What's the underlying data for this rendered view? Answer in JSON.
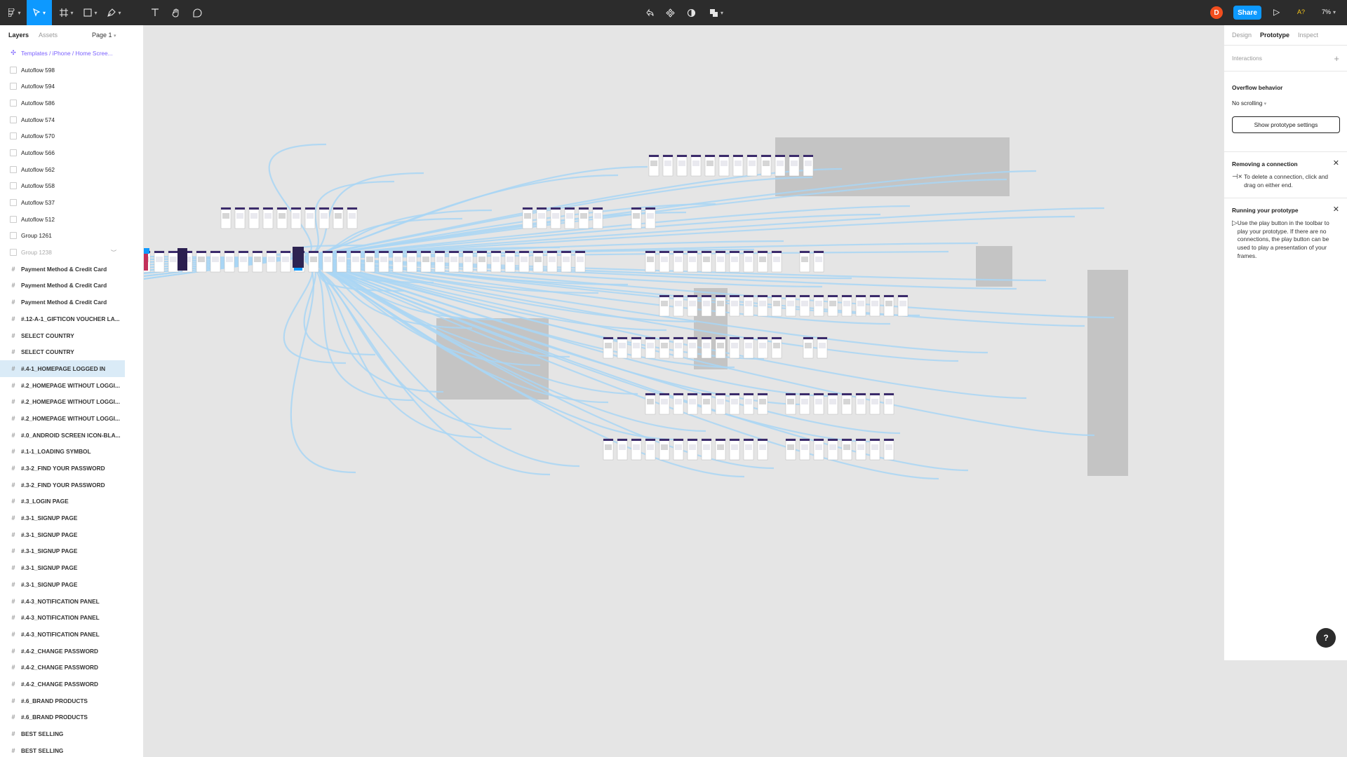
{
  "toolbar": {
    "user_initial": "D",
    "share_label": "Share",
    "aa_label": "A?",
    "zoom_label": "7%"
  },
  "left_panel": {
    "tab_layers": "Layers",
    "tab_assets": "Assets",
    "page_label": "Page 1",
    "layers": [
      {
        "label": "Templates / iPhone / Home Scree...",
        "kind": "component"
      },
      {
        "label": "Autoflow 598",
        "kind": "autoflow"
      },
      {
        "label": "Autoflow 594",
        "kind": "autoflow"
      },
      {
        "label": "Autoflow 586",
        "kind": "autoflow"
      },
      {
        "label": "Autoflow 574",
        "kind": "autoflow"
      },
      {
        "label": "Autoflow 570",
        "kind": "autoflow"
      },
      {
        "label": "Autoflow 566",
        "kind": "autoflow"
      },
      {
        "label": "Autoflow 562",
        "kind": "autoflow"
      },
      {
        "label": "Autoflow 558",
        "kind": "autoflow"
      },
      {
        "label": "Autoflow 537",
        "kind": "autoflow"
      },
      {
        "label": "Autoflow 512",
        "kind": "autoflow"
      },
      {
        "label": "Group 1261",
        "kind": "group"
      },
      {
        "label": "Group 1238",
        "kind": "group-hidden"
      },
      {
        "label": "Payment Method & Credit Card",
        "kind": "frame"
      },
      {
        "label": "Payment Method & Credit Card",
        "kind": "frame"
      },
      {
        "label": "Payment Method & Credit Card",
        "kind": "frame"
      },
      {
        "label": "#.12-A-1_GIFTICON VOUCHER LA...",
        "kind": "frame"
      },
      {
        "label": "SELECT COUNTRY",
        "kind": "frame"
      },
      {
        "label": "SELECT COUNTRY",
        "kind": "frame"
      },
      {
        "label": "#.4-1_HOMEPAGE LOGGED IN",
        "kind": "frame-selected"
      },
      {
        "label": "#.2_HOMEPAGE WITHOUT LOGGI...",
        "kind": "frame"
      },
      {
        "label": "#.2_HOMEPAGE WITHOUT LOGGI...",
        "kind": "frame"
      },
      {
        "label": "#.2_HOMEPAGE WITHOUT LOGGI...",
        "kind": "frame"
      },
      {
        "label": "#.0_ANDROID SCREEN ICON-BLA...",
        "kind": "frame"
      },
      {
        "label": "#.1-1_LOADING SYMBOL",
        "kind": "frame"
      },
      {
        "label": "#.3-2_FIND YOUR PASSWORD",
        "kind": "frame"
      },
      {
        "label": "#.3-2_FIND YOUR PASSWORD",
        "kind": "frame"
      },
      {
        "label": "#.3_LOGIN PAGE",
        "kind": "frame"
      },
      {
        "label": "#.3-1_SIGNUP PAGE",
        "kind": "frame"
      },
      {
        "label": "#.3-1_SIGNUP PAGE",
        "kind": "frame"
      },
      {
        "label": "#.3-1_SIGNUP PAGE",
        "kind": "frame"
      },
      {
        "label": "#.3-1_SIGNUP PAGE",
        "kind": "frame"
      },
      {
        "label": "#.3-1_SIGNUP PAGE",
        "kind": "frame"
      },
      {
        "label": "#.4-3_NOTIFICATION PANEL",
        "kind": "frame"
      },
      {
        "label": "#.4-3_NOTIFICATION PANEL",
        "kind": "frame"
      },
      {
        "label": "#.4-3_NOTIFICATION PANEL",
        "kind": "frame"
      },
      {
        "label": "#.4-2_CHANGE PASSWORD",
        "kind": "frame"
      },
      {
        "label": "#.4-2_CHANGE PASSWORD",
        "kind": "frame"
      },
      {
        "label": "#.4-2_CHANGE PASSWORD",
        "kind": "frame"
      },
      {
        "label": "#.6_BRAND PRODUCTS",
        "kind": "frame"
      },
      {
        "label": "#.6_BRAND PRODUCTS",
        "kind": "frame"
      },
      {
        "label": "BEST SELLING",
        "kind": "frame"
      },
      {
        "label": "BEST SELLING",
        "kind": "frame"
      }
    ]
  },
  "right_panel": {
    "tab_design": "Design",
    "tab_prototype": "Prototype",
    "tab_inspect": "Inspect",
    "interactions_label": "Interactions",
    "overflow_title": "Overflow behavior",
    "overflow_value": "No scrolling",
    "settings_button": "Show prototype settings",
    "tip1_title": "Removing a connection",
    "tip1_body": "To delete a connection, click and drag on either end.",
    "tip2_title": "Running your prototype",
    "tip2_body": "Use the play button in the toolbar to play your prototype. If there are no connections, the play button can be used to play a presentation of your frames."
  },
  "help_label": "?",
  "colors": {
    "toolbar_bg": "#2c2c2c",
    "accent": "#0d99ff",
    "canvas_bg": "#e5e5e5",
    "connector": "#a9d6f5",
    "section_fill": "#c4c4c4",
    "avatar": "#f24e1e"
  }
}
